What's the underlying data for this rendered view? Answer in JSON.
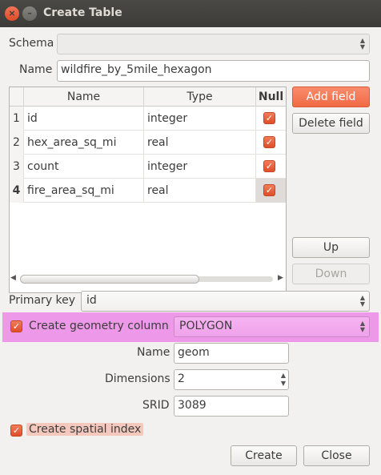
{
  "window": {
    "title": "Create Table",
    "close_glyph": "×",
    "min_glyph": "–"
  },
  "schema": {
    "label": "Schema",
    "value": ""
  },
  "name_field": {
    "label": "Name",
    "value": "wildfire_by_5mile_hexagon"
  },
  "table": {
    "headers": {
      "name": "Name",
      "type": "Type",
      "null": "Null"
    },
    "rows": [
      {
        "num": "1",
        "name": "id",
        "type": "integer",
        "null": true
      },
      {
        "num": "2",
        "name": "hex_area_sq_mi",
        "type": "real",
        "null": true
      },
      {
        "num": "3",
        "name": "count",
        "type": "integer",
        "null": true
      },
      {
        "num": "4",
        "name": "fire_area_sq_mi",
        "type": "real",
        "null": true
      }
    ]
  },
  "buttons": {
    "add_field": "Add field",
    "delete_field": "Delete field",
    "up": "Up",
    "down": "Down",
    "create": "Create",
    "close": "Close"
  },
  "primary_key": {
    "label": "Primary key",
    "value": "id"
  },
  "geometry": {
    "checkbox_label": "Create geometry column",
    "type": "POLYGON",
    "name_label": "Name",
    "name_value": "geom",
    "dimensions_label": "Dimensions",
    "dimensions_value": "2",
    "srid_label": "SRID",
    "srid_value": "3089"
  },
  "spatial_index": {
    "label": "Create spatial index"
  },
  "glyphs": {
    "check": "✓",
    "combo_up": "▲",
    "combo_down": "▼",
    "left": "◀",
    "right": "▶"
  },
  "colors": {
    "accent": "#f06a45",
    "highlight": "#ed98e8",
    "titlebar": "#3c3b37"
  }
}
